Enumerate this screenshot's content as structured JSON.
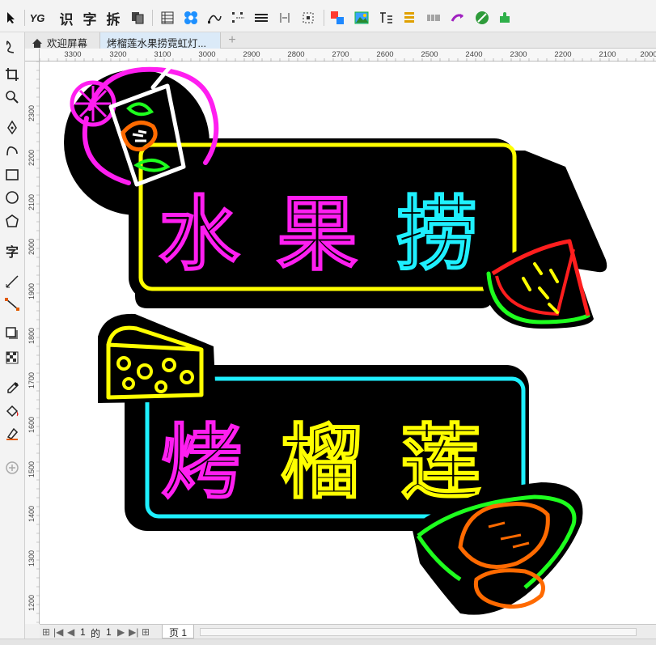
{
  "toolbar": {
    "ocr_chars": [
      "识",
      "字",
      "拆"
    ],
    "yg_label": "YG"
  },
  "tabs": [
    {
      "label": "欢迎屏幕"
    },
    {
      "label": "烤榴莲水果捞霓虹灯..."
    }
  ],
  "ruler": {
    "h_labels": [
      "3300",
      "3200",
      "3100",
      "3000",
      "2900",
      "2800",
      "2700",
      "2600",
      "2500",
      "2400",
      "2300",
      "2200",
      "2100",
      "2000"
    ],
    "v_labels": [
      "2300",
      "2200",
      "2100",
      "2000",
      "1900",
      "1800",
      "1700",
      "1600",
      "1500",
      "1400",
      "1300",
      "1200"
    ]
  },
  "design": {
    "sign1_text": [
      "水",
      "果",
      "捞"
    ],
    "sign2_text": [
      "烤",
      "榴",
      "莲"
    ]
  },
  "pagebar": {
    "current": "1",
    "of_label": "的",
    "total": "1",
    "page_tab": "页 1"
  },
  "colors": {
    "magenta": "#ff1ef0",
    "cyan": "#1ef0ff",
    "yellow": "#ffff00",
    "green": "#1eff1e",
    "orange": "#ff6a00",
    "red": "#ff1e1e"
  }
}
